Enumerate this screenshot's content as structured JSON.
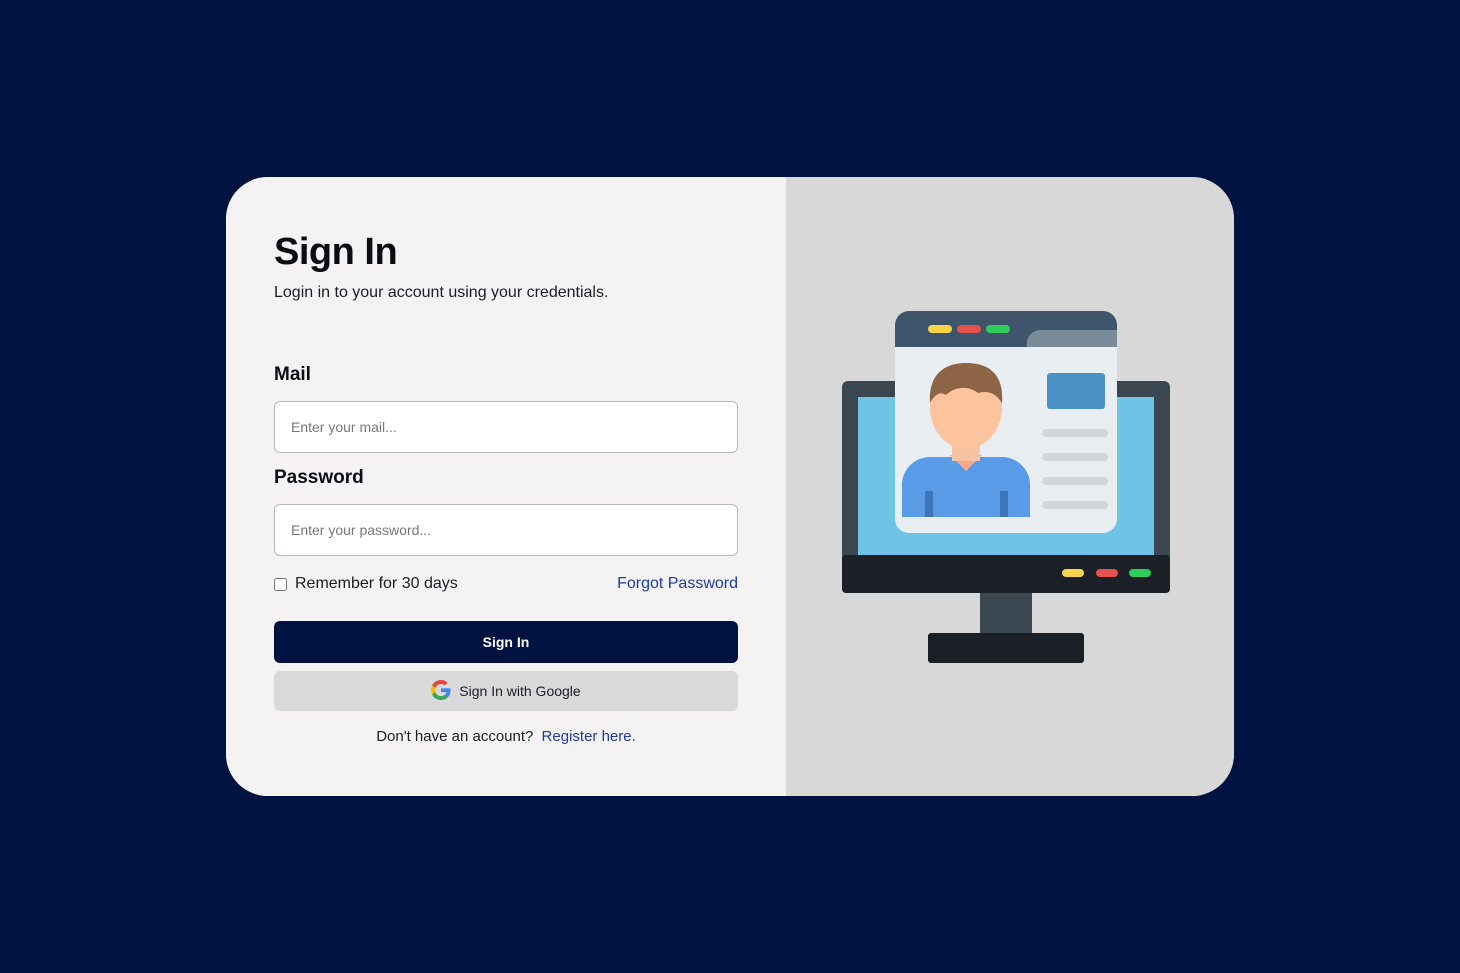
{
  "signin": {
    "title": "Sign In",
    "subtitle": "Login in to your account using your credentials.",
    "mail_label": "Mail",
    "mail_placeholder": "Enter your mail...",
    "password_label": "Password",
    "password_placeholder": "Enter your password...",
    "remember_label": "Remember for 30 days",
    "remember_checked": false,
    "forgot_label": "Forgot Password",
    "signin_button": "Sign In",
    "google_button": "Sign In with Google",
    "register_prompt": "Don't have an account?",
    "register_link": "Register here."
  },
  "illustration": {
    "icon": "monitor-profile-icon"
  },
  "colors": {
    "background": "#001240",
    "card_left": "#f4f2f3",
    "card_right": "#d8d8d8",
    "primary_button": "#001240",
    "link": "#1b3aa8"
  }
}
